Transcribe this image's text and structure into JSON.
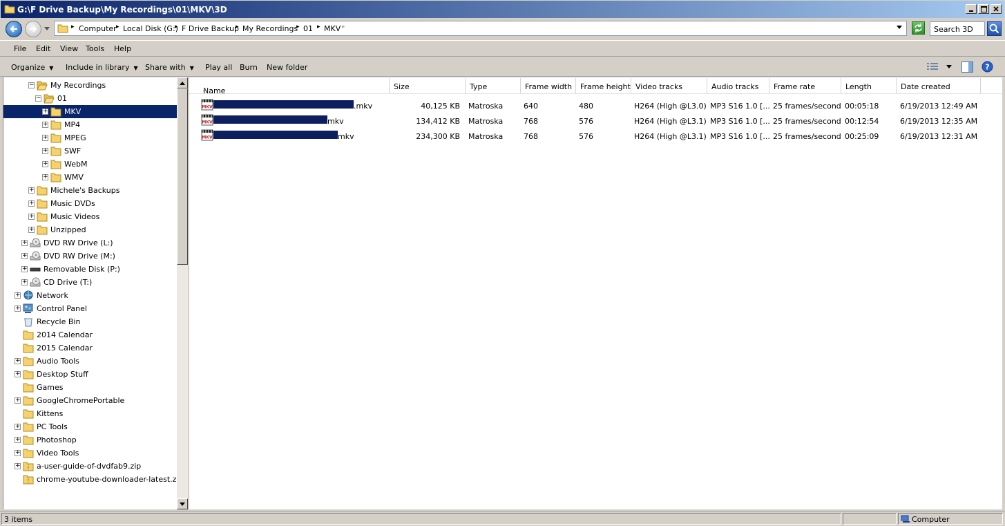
{
  "window": {
    "title": "G:\\F Drive Backup\\My Recordings\\01\\MKV\\3D"
  },
  "address": {
    "crumbs": [
      "Computer",
      "Local Disk (G:)",
      "F Drive Backup",
      "My Recordings",
      "01",
      "MKV"
    ]
  },
  "search": {
    "placeholder": "Search 3D"
  },
  "menu": {
    "file": "File",
    "edit": "Edit",
    "view": "View",
    "tools": "Tools",
    "help": "Help"
  },
  "commands": {
    "organize": "Organize",
    "include_in_library": "Include in library",
    "share_with": "Share with",
    "play_all": "Play all",
    "burn": "Burn",
    "new_folder": "New folder"
  },
  "tree": [
    {
      "label": "My Recordings",
      "expander": "minus",
      "icon": "folder-open-icon"
    },
    {
      "label": "01",
      "expander": "minus",
      "icon": "folder-open-icon"
    },
    {
      "label": "MKV",
      "expander": "plus",
      "icon": "folder-icon",
      "selected": true
    },
    {
      "label": "MP4",
      "expander": "plus",
      "icon": "folder-icon"
    },
    {
      "label": "MPEG",
      "expander": "plus",
      "icon": "folder-icon"
    },
    {
      "label": "SWF",
      "expander": "plus",
      "icon": "folder-icon"
    },
    {
      "label": "WebM",
      "expander": "plus",
      "icon": "folder-icon"
    },
    {
      "label": "WMV",
      "expander": "plus",
      "icon": "folder-icon"
    },
    {
      "label": "Michele's Backups",
      "expander": "plus",
      "icon": "folder-icon"
    },
    {
      "label": "Music DVDs",
      "expander": "plus",
      "icon": "folder-icon"
    },
    {
      "label": "Music Videos",
      "expander": "plus",
      "icon": "folder-icon"
    },
    {
      "label": "Unzipped",
      "expander": "plus",
      "icon": "folder-icon"
    },
    {
      "label": "DVD RW Drive (L:)",
      "expander": "plus",
      "icon": "dvd-drive-icon"
    },
    {
      "label": "DVD RW Drive (M:)",
      "expander": "plus",
      "icon": "dvd-drive-icon"
    },
    {
      "label": "Removable Disk (P:)",
      "expander": "plus",
      "icon": "removable-disk-icon"
    },
    {
      "label": "CD Drive (T:)",
      "expander": "plus",
      "icon": "dvd-drive-icon"
    },
    {
      "label": "Network",
      "expander": "plus",
      "icon": "network-icon"
    },
    {
      "label": "Control Panel",
      "expander": "plus",
      "icon": "control-panel-icon"
    },
    {
      "label": "Recycle Bin",
      "expander": "none",
      "icon": "recycle-bin-icon"
    },
    {
      "label": "2014 Calendar",
      "expander": "none",
      "icon": "folder-icon"
    },
    {
      "label": "2015 Calendar",
      "expander": "none",
      "icon": "folder-icon"
    },
    {
      "label": "Audio Tools",
      "expander": "plus",
      "icon": "folder-icon"
    },
    {
      "label": "Desktop Stuff",
      "expander": "plus",
      "icon": "folder-icon"
    },
    {
      "label": "Games",
      "expander": "none",
      "icon": "folder-icon"
    },
    {
      "label": "GoogleChromePortable",
      "expander": "plus",
      "icon": "folder-icon"
    },
    {
      "label": "Kittens",
      "expander": "none",
      "icon": "folder-icon"
    },
    {
      "label": "PC Tools",
      "expander": "plus",
      "icon": "folder-icon"
    },
    {
      "label": "Photoshop",
      "expander": "plus",
      "icon": "folder-icon"
    },
    {
      "label": "Video Tools",
      "expander": "plus",
      "icon": "folder-icon"
    },
    {
      "label": "a-user-guide-of-dvdfab9.zip",
      "expander": "plus",
      "icon": "zip-folder-icon"
    },
    {
      "label": "chrome-youtube-downloader-latest.zip",
      "expander": "none",
      "icon": "zip-folder-icon"
    }
  ],
  "columns": [
    "Name",
    "Size",
    "Type",
    "Frame width",
    "Frame height",
    "Video tracks",
    "Audio tracks",
    "Frame rate",
    "Length",
    "Date created"
  ],
  "files": [
    {
      "name": ".mkv",
      "size": "40,125 KB",
      "type": "Matroska",
      "frame_width": "640",
      "frame_height": "480",
      "video_tracks": "H264 (High @L3.0)",
      "audio_tracks": "MP3 S16 1.0 [...",
      "frame_rate": "25 frames/second",
      "length": "00:05:18",
      "date_created": "6/19/2013 12:49 AM"
    },
    {
      "name": "mkv",
      "size": "134,412 KB",
      "type": "Matroska",
      "frame_width": "768",
      "frame_height": "576",
      "video_tracks": "H264 (High @L3.1)",
      "audio_tracks": "MP3 S16 1.0 [...",
      "frame_rate": "25 frames/second",
      "length": "00:12:54",
      "date_created": "6/19/2013 12:35 AM"
    },
    {
      "name": "mkv",
      "size": "234,300 KB",
      "type": "Matroska",
      "frame_width": "768",
      "frame_height": "576",
      "video_tracks": "H264 (High @L3.1)",
      "audio_tracks": "MP3 S16 1.0 [...",
      "frame_rate": "25 frames/second",
      "length": "00:25:09",
      "date_created": "6/19/2013 12:31 AM"
    }
  ],
  "status": {
    "items": "3 items",
    "location": "Computer"
  }
}
